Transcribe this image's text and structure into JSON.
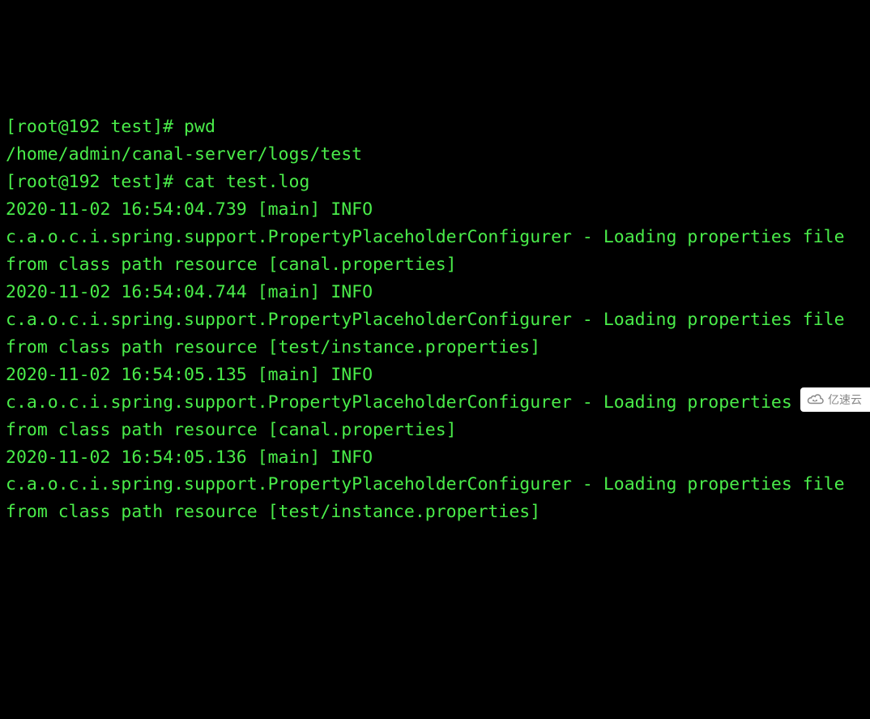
{
  "terminal": {
    "lines": [
      "[root@192 test]# pwd",
      "/home/admin/canal-server/logs/test",
      "[root@192 test]# cat test.log",
      "2020-11-02 16:54:04.739 [main] INFO  c.a.o.c.i.spring.support.PropertyPlaceholderConfigurer - Loading properties file from class path resource [canal.properties]",
      "2020-11-02 16:54:04.744 [main] INFO  c.a.o.c.i.spring.support.PropertyPlaceholderConfigurer - Loading properties file from class path resource [test/instance.properties]",
      "2020-11-02 16:54:05.135 [main] INFO  c.a.o.c.i.spring.support.PropertyPlaceholderConfigurer - Loading properties file from class path resource [canal.properties]",
      "2020-11-02 16:54:05.136 [main] INFO  c.a.o.c.i.spring.support.PropertyPlaceholderConfigurer - Loading properties file from class path resource [test/instance.properties]"
    ]
  },
  "watermark": {
    "text": "亿速云"
  }
}
